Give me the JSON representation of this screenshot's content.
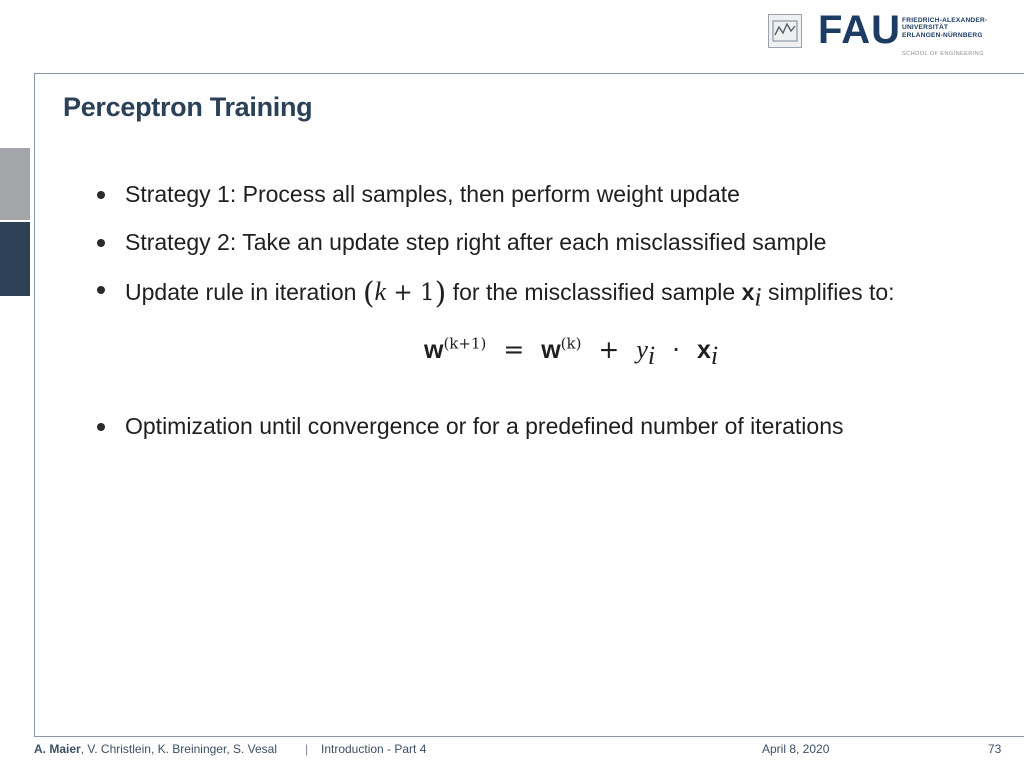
{
  "header": {
    "logo_left_icon": "tf-logo-icon",
    "fau_wordmark": "FAU",
    "fau_lines": [
      "FRIEDRICH-ALEXANDER-",
      "UNIVERSITÄT",
      "ERLANGEN-NÜRNBERG"
    ],
    "school": "SCHOOL OF ENGINEERING"
  },
  "slide": {
    "title": "Perceptron Training",
    "bullets": [
      "Strategy 1: Process all samples, then perform weight update",
      "Strategy 2: Take an update step right after each misclassified sample",
      {
        "prefix": "Update rule in iteration",
        "iter_k": "k",
        "iter_op": "+ 1",
        "middle": "for the misclassified sample",
        "vec": "x",
        "vec_sub": "i",
        "suffix": "simplifies to:"
      },
      "Optimization until convergence or for a predefined number of iterations"
    ],
    "equation": {
      "lhs": "w",
      "lhs_sup": "(k+1)",
      "eq": "=",
      "rhs_w": "w",
      "rhs_sup": "(k)",
      "plus": "+",
      "y": "y",
      "y_sub": "i",
      "dot": "·",
      "x": "x",
      "x_sub": "i"
    }
  },
  "footer": {
    "lead_author": "A. Maier",
    "coauthors": ", V. Christlein, K. Breininger, S. Vesal",
    "separator": "|",
    "course": "Introduction - Part 4",
    "date": "April 8, 2020",
    "page": "73"
  },
  "colors": {
    "title": "#2b4157",
    "brand": "#1d3c64",
    "side_tab_dark": "#2e4156",
    "side_tab_gray": "#a3a5a8"
  }
}
